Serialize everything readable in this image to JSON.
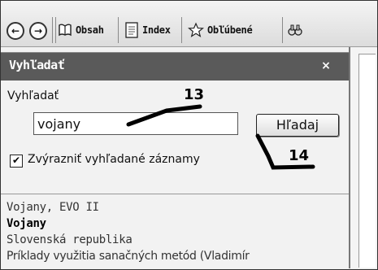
{
  "toolbar": {
    "back_symbol": "←",
    "forward_symbol": "→",
    "buttons": {
      "contents": "Obsah",
      "index": "Index",
      "favorites": "Obľúbené"
    }
  },
  "panel": {
    "title": "Vyhľadať",
    "close_symbol": "×",
    "search_label": "Vyhľadať",
    "search_value": "vojany",
    "search_button": "Hľadaj",
    "highlight_checked": true,
    "highlight_label": "Zvýrazniť vyhľadané záznamy"
  },
  "results": [
    "Vojany, EVO II",
    "Vojany",
    "Slovenská republika",
    "Príklady využitia sanačných metód (Vladimír"
  ],
  "annotations": {
    "label_13": "13",
    "label_14": "14"
  }
}
